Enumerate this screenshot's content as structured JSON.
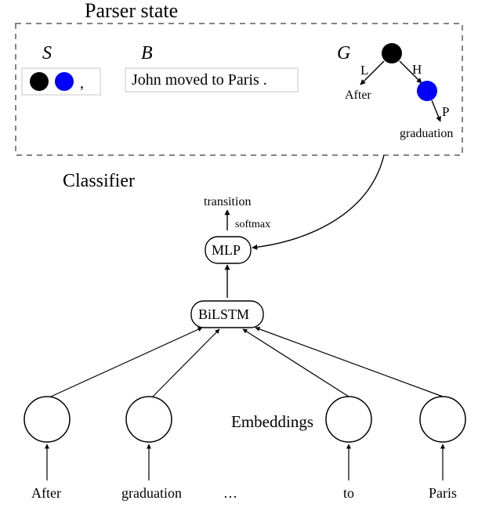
{
  "title": "Parser state",
  "parser_state": {
    "S_label": "S",
    "B_label": "B",
    "G_label": "G",
    "S_box_trailing": " , ",
    "B_text": "John moved to Paris .",
    "G": {
      "edge_L": "L",
      "edge_H": "H",
      "edge_P": "P",
      "leaf_left": "After",
      "leaf_right": "graduation"
    }
  },
  "classifier": {
    "label": "Classifier",
    "transition": "transition",
    "softmax": "softmax",
    "mlp": "MLP",
    "bilstm": "BiLSTM",
    "embeddings_label": "Embeddings",
    "tokens": {
      "t1": "After",
      "t2": "graduation",
      "t3": "…",
      "t4": "to",
      "t5": "Paris"
    }
  }
}
